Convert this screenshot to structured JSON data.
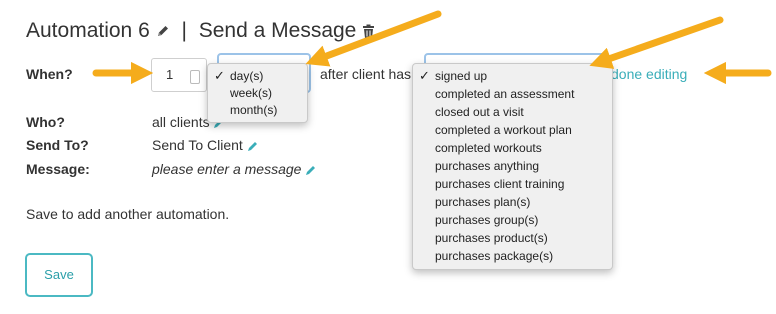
{
  "header": {
    "title": "Automation 6",
    "separator": "|",
    "subtitle": "Send a Message"
  },
  "form": {
    "when_label": "When?",
    "quantity_value": "1",
    "unit_selected": "day(s)",
    "after_text": "after client has",
    "done_editing": "done editing",
    "who_label": "Who?",
    "who_value": "all clients",
    "send_to_label": "Send To?",
    "send_to_value": "Send To Client",
    "message_label": "Message:",
    "message_value": "please enter a message"
  },
  "unit_menu": {
    "options": [
      "day(s)",
      "week(s)",
      "month(s)"
    ],
    "selected_index": 0
  },
  "event_menu": {
    "options": [
      "signed up",
      "completed an assessment",
      "closed out a visit",
      "completed a workout plan",
      "completed workouts",
      "purchases anything",
      "purchases client training",
      "purchases plan(s)",
      "purchases group(s)",
      "purchases product(s)",
      "purchases package(s)"
    ],
    "selected_index": 0
  },
  "footer": {
    "hint": "Save to add another automation.",
    "save_label": "Save"
  },
  "colors": {
    "accent": "#3aaeb9",
    "arrow": "#f5ac1c",
    "focus_border": "#9cc3e8"
  }
}
